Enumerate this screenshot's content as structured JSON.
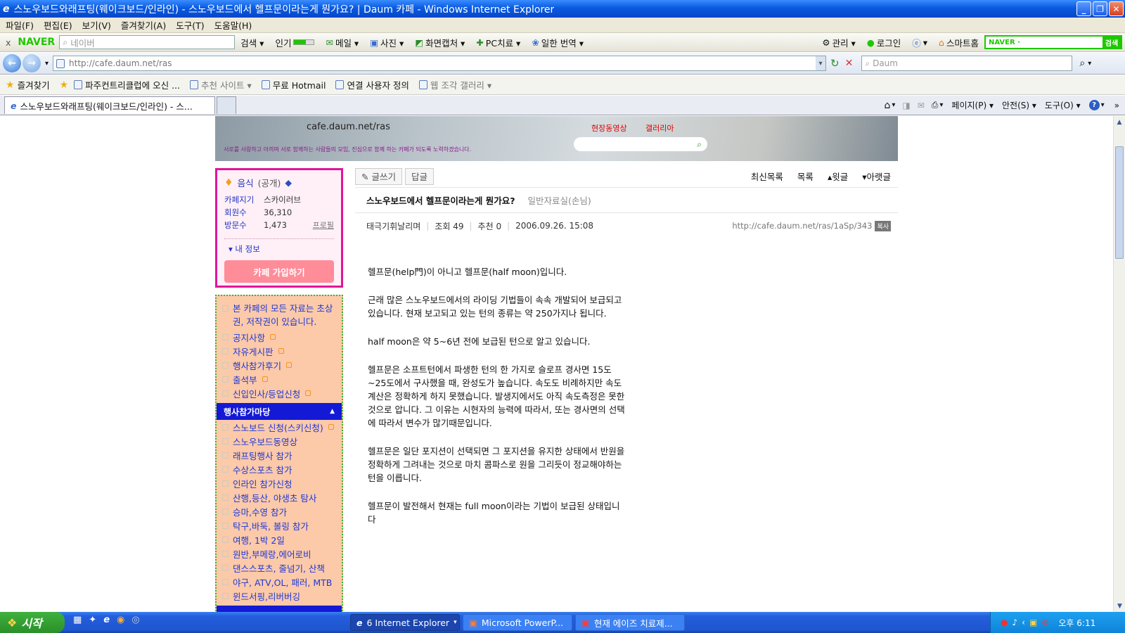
{
  "window": {
    "title": "스노우보드와래프팅(웨이크보드/인라인) - 스노우보드에서 헬프문이라는게 뭔가요? | Daum 카페 - Windows Internet Explorer",
    "minimize": "_",
    "restore": "❐",
    "close": "✕"
  },
  "menu": [
    "파일(F)",
    "편집(E)",
    "보기(V)",
    "즐겨찾기(A)",
    "도구(T)",
    "도움말(H)"
  ],
  "naverbar": {
    "close": "x",
    "brand": "NAVER",
    "search_placeholder": "네이버",
    "items": [
      "검색 ▾",
      "인기",
      "메일 ▾",
      "사진 ▾",
      "화면캡처 ▾",
      "PC치료 ▾",
      "일한 번역 ▾"
    ],
    "right_items": [
      "관리 ▾",
      "로그인",
      "▾",
      "스마트홈"
    ],
    "right_search_brand": "NAVER ·",
    "right_search_btn": "검색"
  },
  "address": {
    "url": "http://cafe.daum.net/ras",
    "search_placeholder": "Daum",
    "back": "←",
    "forward": "→",
    "dropdown": "▾"
  },
  "favorites": {
    "label": "즐겨찾기",
    "items": [
      "파주컨트리클럽에 오신 ...",
      "추천 사이트 ▾",
      "무료 Hotmail",
      "연결 사용자 정의",
      "웹 조각 갤러리 ▾"
    ]
  },
  "tab": {
    "label": "스노우보드와래프팅(웨이크보드/인라인) - 스..."
  },
  "commandbar": [
    "▾",
    "▾",
    "페이지(P) ▾",
    "안전(S) ▾",
    "도구(O) ▾",
    "▾",
    "»"
  ],
  "banner": {
    "url_text": "cafe.daum.net/ras",
    "link1": "현장동영상",
    "link2": "갤러리아",
    "tagline": "서로를 사랑하고 아끼며 서로 함께하는 사람들의 모임, 진심으로 함께 하는 카페가 되도록 노력하겠습니다."
  },
  "cafe_info": {
    "category": "음식",
    "visibility": "(공개)",
    "rows": [
      {
        "label": "카페지기",
        "value": "스카이러브"
      },
      {
        "label": "회원수",
        "value": "36,310"
      },
      {
        "label": "방문수",
        "value": "1,473"
      }
    ],
    "profile_link": "프로필",
    "my_info": "▾ 내 정보",
    "join_button": "카페 가입하기"
  },
  "menus_top": [
    "본 카페의 모든 자료는 초상권, 저작권이 있습니다.",
    "공지사항",
    "자유게시판",
    "행사참가후기",
    "출석부",
    "신입인사/등업신청"
  ],
  "menu_section": {
    "title": "행사참가마당",
    "arrow": "▲"
  },
  "menus_bottom": [
    "스노보드 신청(스키신청)",
    "스노우보드동영상",
    "래프팅행사 참가",
    "수상스포츠 참가",
    "인라인 참가신청",
    "산행,등산, 야생초 탐사",
    "승마,수영 참가",
    "탁구,바둑, 볼링 참가",
    "여행, 1박 2일",
    "원반,부메랑,에어로비",
    "댄스스포츠, 줄넘기, 산책",
    "야구, ATV,OL, 패러, MTB",
    "윈드서핑,리버버깅"
  ],
  "article_toolbar": {
    "write": "✎ 글쓰기",
    "reply": "답글",
    "recent": "최신목록",
    "list": "목록",
    "prev": "▴윗글",
    "next": "▾아랫글"
  },
  "article": {
    "title": "스노우보드에서 헬프문이라는게 뭔가요?",
    "board": "일반자료실(손님)",
    "author": "태극기휘날리며",
    "views": "조회 49",
    "recommend": "추천 0",
    "date": "2006.09.26. 15:08",
    "permalink": "http://cafe.daum.net/ras/1aSp/343",
    "copy": "복사",
    "paragraphs": [
      "헬프문(help門)이 아니고 헬프문(half moon)입니다.",
      "근래 많은 스노우보드에서의 라이딩 기법들이 속속 개발되어 보급되고 있습니다. 현재 보고되고 있는 턴의 종류는 약 250가지나 됩니다.",
      "half moon은 약 5~6년 전에 보급된 턴으로 알고 있습니다.",
      "헬프문은 소프트턴에서 파생한 턴의 한 가지로 슬로프 경사면 15도~25도에서 구사했을 때, 완성도가 높습니다. 속도도 비례하지만 속도 계산은 정확하게 하지 못했습니다. 발생지에서도 아직 속도측정은 못한 것으로 압니다. 그 이유는 시현자의 능력에 따라서, 또는 경사면의 선택에 따라서 변수가 많기때문입니다.",
      "헬프문은 일단 포지션이 선택되면 그 포지션을 유지한 상태에서 반원을 정확하게 그려내는 것으로 마치 콤파스로 원을 그리듯이 정교해야하는 턴을 이릅니다.",
      "헬프문이 발전해서 현재는 full moon이라는 기법이 보급된 상태입니다"
    ]
  },
  "taskbar": {
    "start": "시작",
    "tasks": [
      "6 Internet Explorer",
      "Microsoft PowerP...",
      "현재 에이즈 치료제..."
    ],
    "clock": "오후 6:11"
  }
}
